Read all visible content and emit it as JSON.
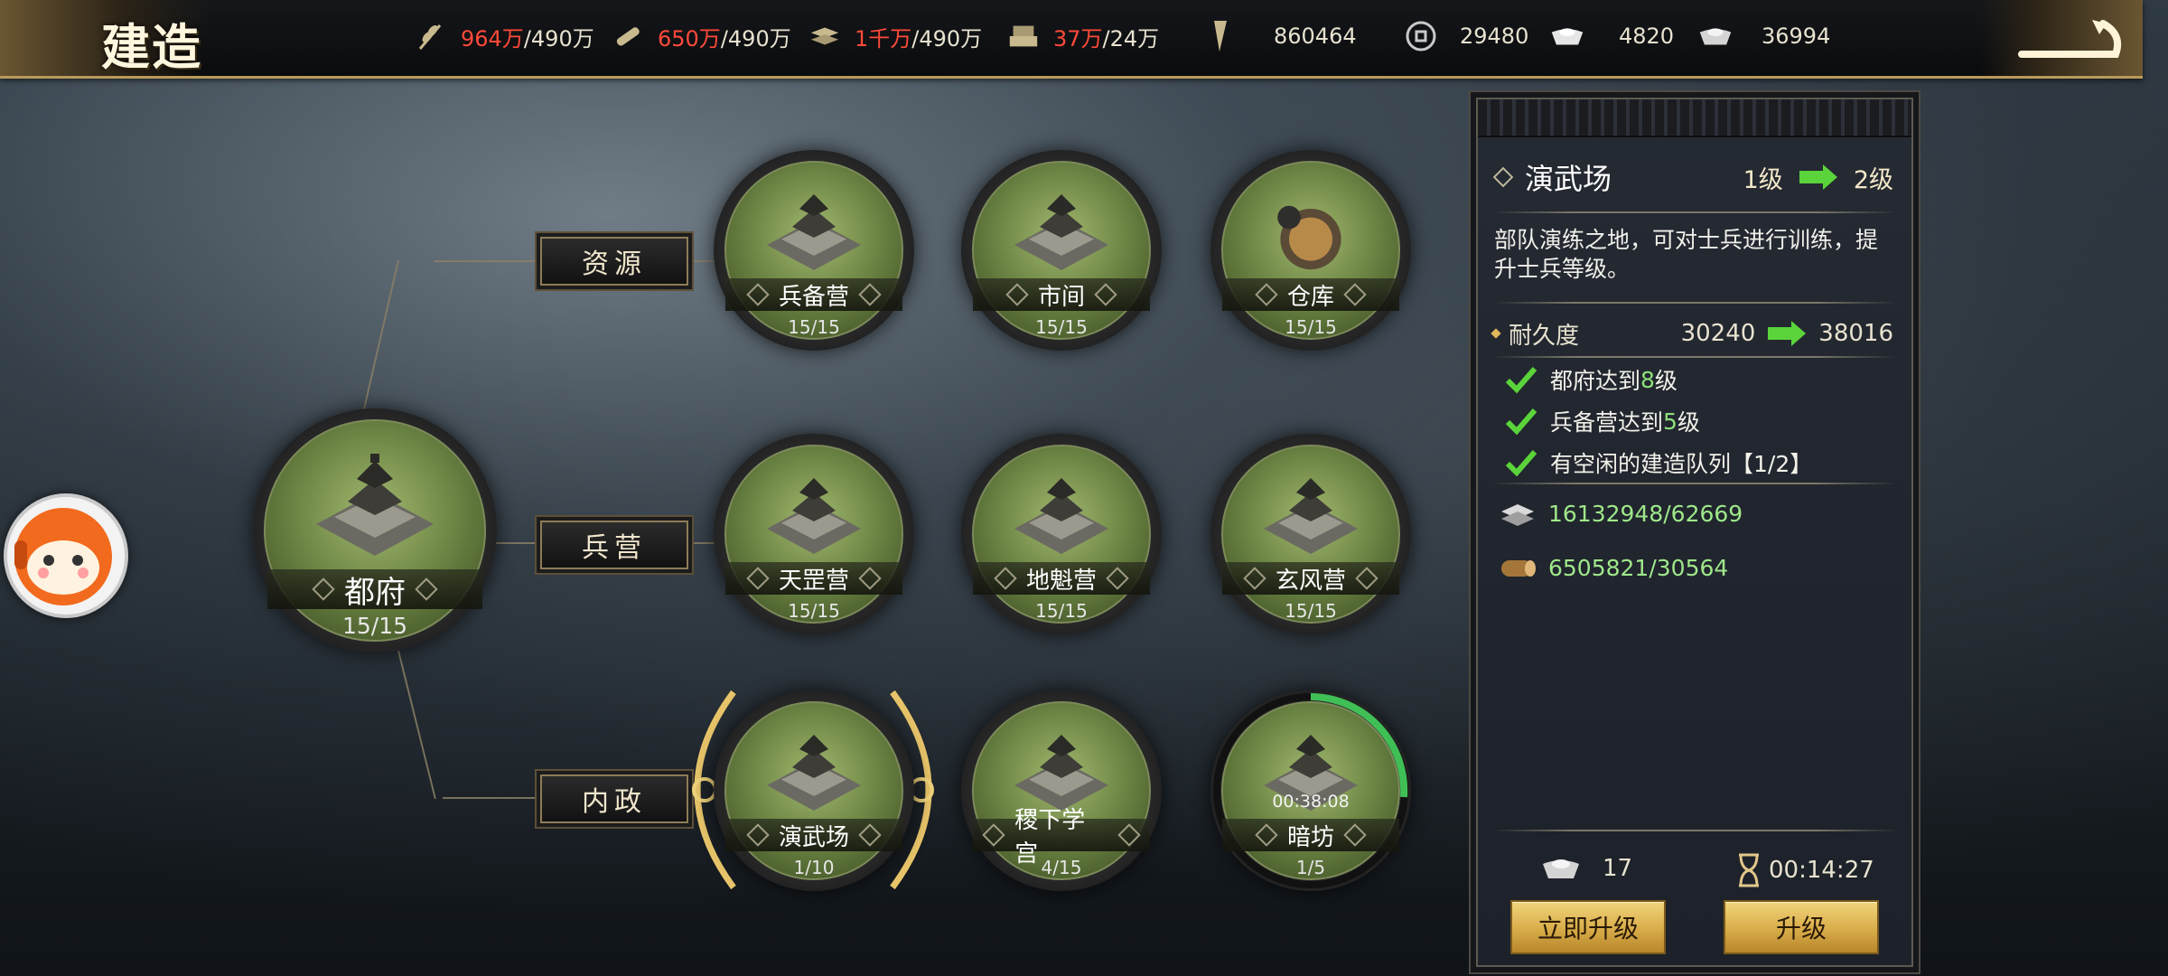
{
  "title": "建造",
  "resources": [
    {
      "icon": "grain-icon",
      "cur": "964万",
      "max": "/490万"
    },
    {
      "icon": "wood-icon",
      "cur": "650万",
      "max": "/490万"
    },
    {
      "icon": "iron-icon",
      "cur": "1千万",
      "max": "/490万"
    },
    {
      "icon": "stone-icon",
      "cur": "37万",
      "max": "/24万"
    },
    {
      "icon": "token-icon",
      "cur": "",
      "max": "860464"
    },
    {
      "icon": "coin-icon",
      "cur": "",
      "max": "29480"
    },
    {
      "icon": "gold-ingot-icon",
      "cur": "",
      "max": "4820"
    },
    {
      "icon": "silver-ingot-icon",
      "cur": "",
      "max": "36994"
    }
  ],
  "categories": {
    "resource": "资源",
    "barracks": "兵营",
    "affairs": "内政"
  },
  "main_building": {
    "name": "都府",
    "level": "15/15"
  },
  "buildings": {
    "b1": {
      "name": "兵备营",
      "level": "15/15"
    },
    "b2": {
      "name": "市间",
      "level": "15/15"
    },
    "b3": {
      "name": "仓库",
      "level": "15/15"
    },
    "b4": {
      "name": "天罡营",
      "level": "15/15"
    },
    "b5": {
      "name": "地魁营",
      "level": "15/15"
    },
    "b6": {
      "name": "玄风营",
      "level": "15/15"
    },
    "b7": {
      "name": "演武场",
      "level": "1/10"
    },
    "b8": {
      "name": "稷下学宫",
      "level": "4/15"
    },
    "b9": {
      "name": "暗坊",
      "level": "1/5",
      "timer": "00:38:08"
    }
  },
  "panel": {
    "title": "演武场",
    "from_level": "1级",
    "to_level": "2级",
    "description": "部队演练之地，可对士兵进行训练，提升士兵等级。",
    "durability_label": "耐久度",
    "durability_from": "30240",
    "durability_to": "38016",
    "requirements": [
      {
        "pre": "都府达到",
        "num": "8",
        "post": "级"
      },
      {
        "pre": "兵备营达到",
        "num": "5",
        "post": "级"
      },
      {
        "pre": "有空闲的建造队列【1/2】",
        "num": "",
        "post": ""
      }
    ],
    "costs": [
      {
        "icon": "iron-resource-icon",
        "value": "16132948/62669"
      },
      {
        "icon": "wood-resource-icon",
        "value": "6505821/30564"
      }
    ],
    "instant_cost": "17",
    "upgrade_time": "00:14:27",
    "instant_button": "立即升级",
    "upgrade_button": "升级"
  },
  "colors": {
    "accent_gold": "#d8ac48",
    "resource_over": "#ff4a3a",
    "requirement_ok": "#8fe07a"
  }
}
